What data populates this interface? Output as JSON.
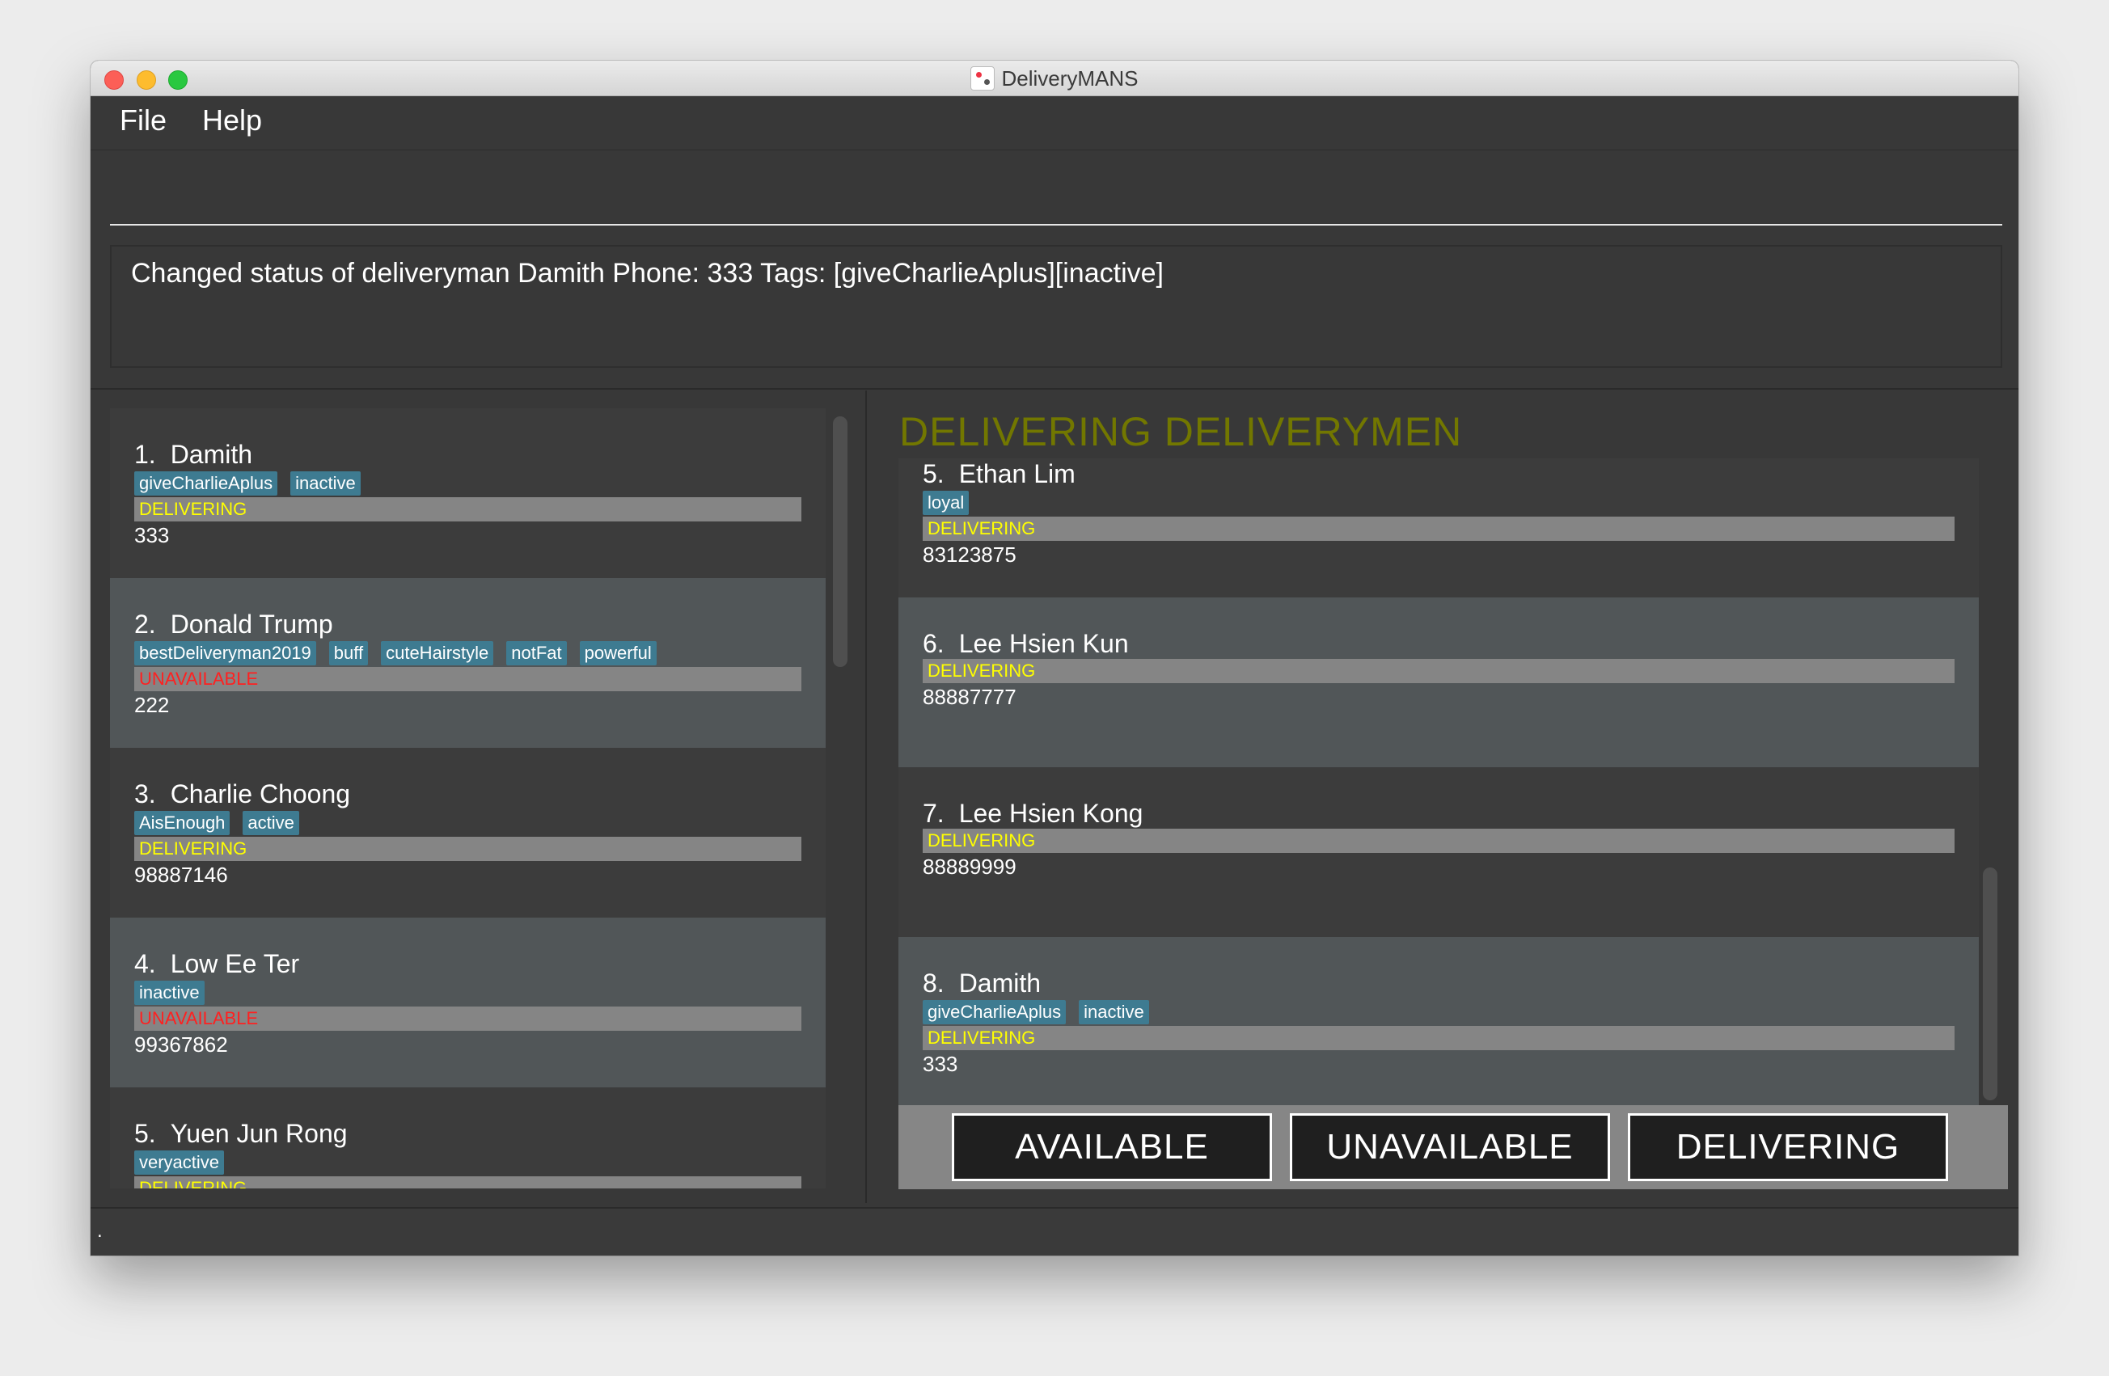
{
  "window": {
    "title": "DeliveryMANS"
  },
  "menu": {
    "file": "File",
    "help": "Help"
  },
  "command": {
    "value": ""
  },
  "result": {
    "text": "Changed status of deliveryman Damith Phone: 333 Tags: [giveCharlieAplus][inactive]"
  },
  "left_list": [
    {
      "index": "1.",
      "name": "Damith",
      "tags": [
        "giveCharlieAplus",
        "inactive"
      ],
      "status": "DELIVERING",
      "phone": "333"
    },
    {
      "index": "2.",
      "name": "Donald Trump",
      "tags": [
        "bestDeliveryman2019",
        "buff",
        "cuteHairstyle",
        "notFat",
        "powerful"
      ],
      "status": "UNAVAILABLE",
      "phone": "222"
    },
    {
      "index": "3.",
      "name": "Charlie Choong",
      "tags": [
        "AisEnough",
        "active"
      ],
      "status": "DELIVERING",
      "phone": "98887146"
    },
    {
      "index": "4.",
      "name": "Low Ee Ter",
      "tags": [
        "inactive"
      ],
      "status": "UNAVAILABLE",
      "phone": "99367862"
    },
    {
      "index": "5.",
      "name": "Yuen Jun Rong",
      "tags": [
        "veryactive"
      ],
      "status": "DELIVERING",
      "phone": ""
    }
  ],
  "right_title": "DELIVERING DELIVERYMEN",
  "right_list": [
    {
      "index": "5.",
      "name": "Ethan Lim",
      "tags": [
        "loyal"
      ],
      "status": "DELIVERING",
      "phone": "83123875"
    },
    {
      "index": "6.",
      "name": "Lee Hsien Kun",
      "tags": [],
      "status": "DELIVERING",
      "phone": "88887777"
    },
    {
      "index": "7.",
      "name": "Lee Hsien Kong",
      "tags": [],
      "status": "DELIVERING",
      "phone": "88889999"
    },
    {
      "index": "8.",
      "name": "Damith",
      "tags": [
        "giveCharlieAplus",
        "inactive"
      ],
      "status": "DELIVERING",
      "phone": "333"
    }
  ],
  "buttons": {
    "available": "AVAILABLE",
    "unavailable": "UNAVAILABLE",
    "delivering": "DELIVERING"
  },
  "status_bar": {
    "text": "."
  },
  "colors": {
    "delivering": "#ffff00",
    "unavailable": "#ff2020",
    "tag_bg": "#3e7b91",
    "title_olive": "#727700"
  }
}
